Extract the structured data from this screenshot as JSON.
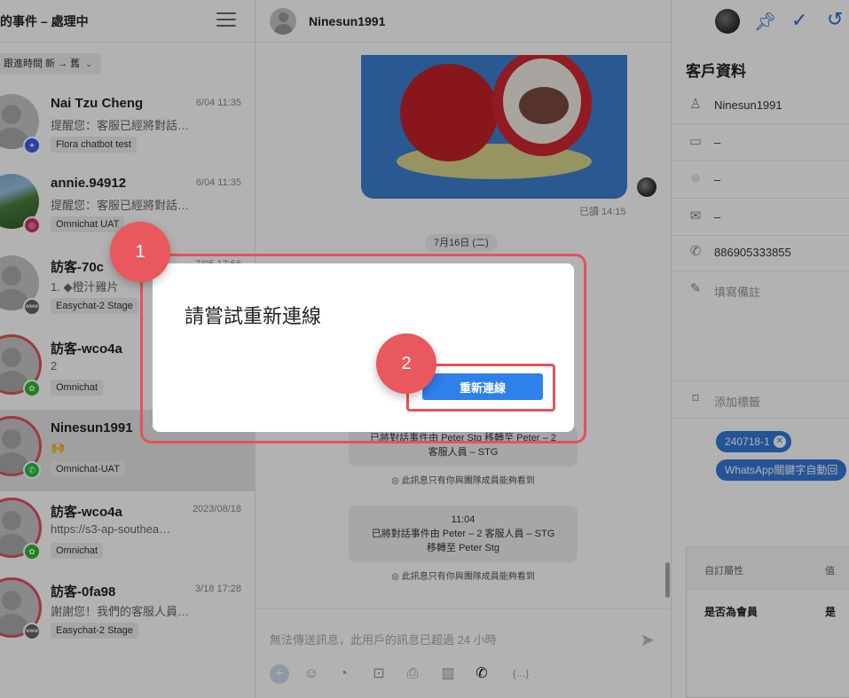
{
  "left_panel": {
    "title": "的事件 – 處理中",
    "sort_label": "跟進時間 新 → 舊",
    "conversations": [
      {
        "name": "Nai Tzu Cheng",
        "time": "6/04 11:35",
        "preview": "提醒您：客服已經將對話…",
        "tag": "Flora chatbot test",
        "channel": "messenger"
      },
      {
        "name": "annie.94912",
        "time": "6/04 11:35",
        "preview": "提醒您：客服已經將對話…",
        "tag": "Omnichat UAT",
        "channel": "instagram"
      },
      {
        "name": "訪客-70c",
        "time": "7/05 17:56",
        "preview": "1. ◆橙汁雞片",
        "tag": "Easychat-2 Stage",
        "channel": "web"
      },
      {
        "name": "訪客-wco4a",
        "time": "",
        "preview": "2",
        "tag": "Omnichat",
        "channel": "wechat"
      },
      {
        "name": "Ninesun1991",
        "time": "",
        "preview": "🙌",
        "tag": "Omnichat-UAT",
        "channel": "whatsapp"
      },
      {
        "name": "訪客-wco4a",
        "time": "2023/08/18",
        "preview": "https://s3-ap-southea…",
        "tag": "Omnichat",
        "channel": "wechat"
      },
      {
        "name": "訪客-0fa98",
        "time": "3/18 17:28",
        "preview": "謝謝您！我們的客服人員…",
        "tag": "Easychat-2 Stage",
        "channel": "web"
      }
    ]
  },
  "chat": {
    "contact_name": "Ninesun1991",
    "read_time": "已讀 14:15",
    "date_divider": "7月16日 (二)",
    "system_messages": [
      {
        "time": "",
        "line1": "已將對話事件由 Peter Stg 移轉至 Peter – 2",
        "line2": "客服人員 – STG",
        "note": "此訊息只有你與團隊成員能夠看到"
      },
      {
        "time": "11:04",
        "line1": "已將對話事件由 Peter – 2 客服人員 – STG",
        "line2": "移轉至 Peter Stg",
        "note": "此訊息只有你與團隊成員能夠看到"
      }
    ],
    "composer_placeholder": "無法傳送訊息，此用戶的訊息已超過 24 小時",
    "variable_tool": "{…}"
  },
  "customer": {
    "title": "客戶資料",
    "name": "Ninesun1991",
    "id_card": "–",
    "location": "–",
    "email": "–",
    "phone": "886905333855",
    "note_placeholder": "填寫備註",
    "add_tag": "添加標籤",
    "tags": [
      "240718-1",
      "WhatsApp關鍵字自動回"
    ],
    "attr_header": {
      "name": "自訂屬性",
      "value": "值"
    },
    "attributes": [
      {
        "name": "是否為會員",
        "value": "是"
      }
    ]
  },
  "modal": {
    "title": "請嘗試重新連線",
    "button_label": "重新連線"
  },
  "annotations": {
    "step1": "1",
    "step2": "2"
  },
  "colors": {
    "accent": "#2f80e8",
    "highlight": "#e4535a",
    "overlay": "rgba(0,0,0,0.30)"
  }
}
